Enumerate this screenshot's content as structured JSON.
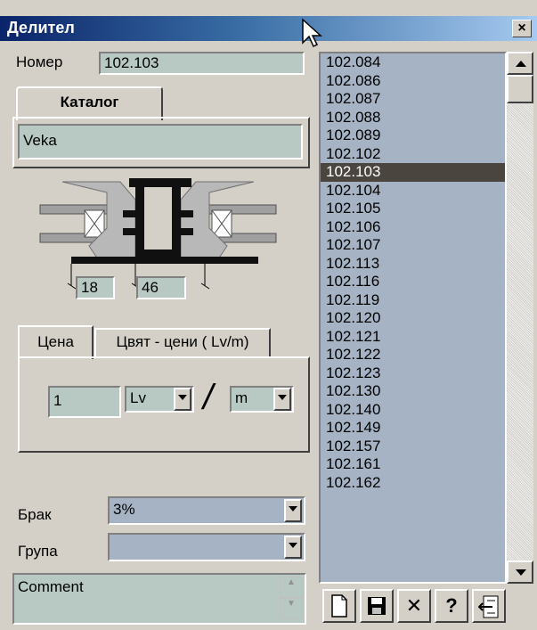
{
  "window": {
    "title": "Делител",
    "close_glyph": "×"
  },
  "form": {
    "number_label": "Номер",
    "number_value": "102.103",
    "catalog_tab": "Каталог",
    "catalog_value": "Veka",
    "dim_left": "18",
    "dim_right": "46",
    "tabs": [
      "Цена",
      "Цвят - цени ( Lv/m)"
    ],
    "price_value": "1",
    "currency": "Lv",
    "slash": "/",
    "unit": "m",
    "defect_label": "Брак",
    "defect_value": "3%",
    "group_label": "Група",
    "group_value": "",
    "comment_value": "Comment"
  },
  "list": {
    "items": [
      "102.084",
      "102.086",
      "102.087",
      "102.088",
      "102.089",
      "102.102",
      "102.103",
      "102.104",
      "102.105",
      "102.106",
      "102.107",
      "102.113",
      "102.116",
      "102.119",
      "102.120",
      "102.121",
      "102.122",
      "102.123",
      "102.130",
      "102.140",
      "102.149",
      "102.157",
      "102.161",
      "102.162"
    ],
    "selected": "102.103"
  },
  "toolbar": {
    "buttons": [
      "new-document-icon",
      "save-icon",
      "delete-icon",
      "help-icon",
      "exit-icon"
    ],
    "help_glyph": "?",
    "delete_glyph": "✕"
  },
  "colors": {
    "field_bg": "#b7c9c2",
    "list_bg": "#a6b3c4",
    "selected_bg": "#4b453f",
    "window_bg": "#d4d0c8"
  }
}
